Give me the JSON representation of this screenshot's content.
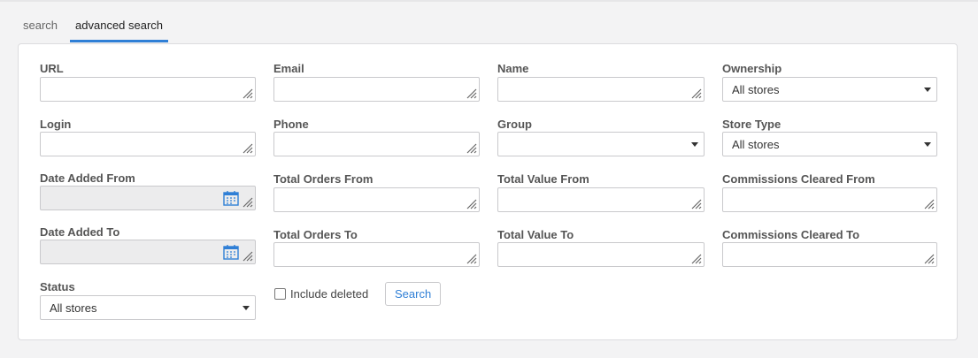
{
  "tabs": [
    {
      "label": "search",
      "active": false
    },
    {
      "label": "advanced search",
      "active": true
    }
  ],
  "form": {
    "url": {
      "label": "URL",
      "value": ""
    },
    "email": {
      "label": "Email",
      "value": ""
    },
    "name": {
      "label": "Name",
      "value": ""
    },
    "ownership": {
      "label": "Ownership",
      "value": "All stores"
    },
    "login": {
      "label": "Login",
      "value": ""
    },
    "phone": {
      "label": "Phone",
      "value": ""
    },
    "group": {
      "label": "Group",
      "value": ""
    },
    "store_type": {
      "label": "Store Type",
      "value": "All stores"
    },
    "date_added_from": {
      "label": "Date Added From",
      "value": ""
    },
    "total_orders_from": {
      "label": "Total Orders From",
      "value": ""
    },
    "total_value_from": {
      "label": "Total Value From",
      "value": ""
    },
    "commissions_cleared_from": {
      "label": "Commissions Cleared From",
      "value": ""
    },
    "date_added_to": {
      "label": "Date Added To",
      "value": ""
    },
    "total_orders_to": {
      "label": "Total Orders To",
      "value": ""
    },
    "total_value_to": {
      "label": "Total Value To",
      "value": ""
    },
    "commissions_cleared_to": {
      "label": "Commissions Cleared To",
      "value": ""
    },
    "status": {
      "label": "Status",
      "value": "All stores"
    },
    "include_deleted": {
      "label": "Include deleted",
      "checked": false
    },
    "search_button": {
      "label": "Search"
    }
  },
  "colors": {
    "accent": "#2f7fd6",
    "panel_border": "#dcdcdf",
    "disabled_bg": "#ececed"
  },
  "icons": {
    "resize_grip": "resize-grip-icon",
    "calendar": "calendar-icon",
    "dropdown": "chevron-down-icon"
  }
}
